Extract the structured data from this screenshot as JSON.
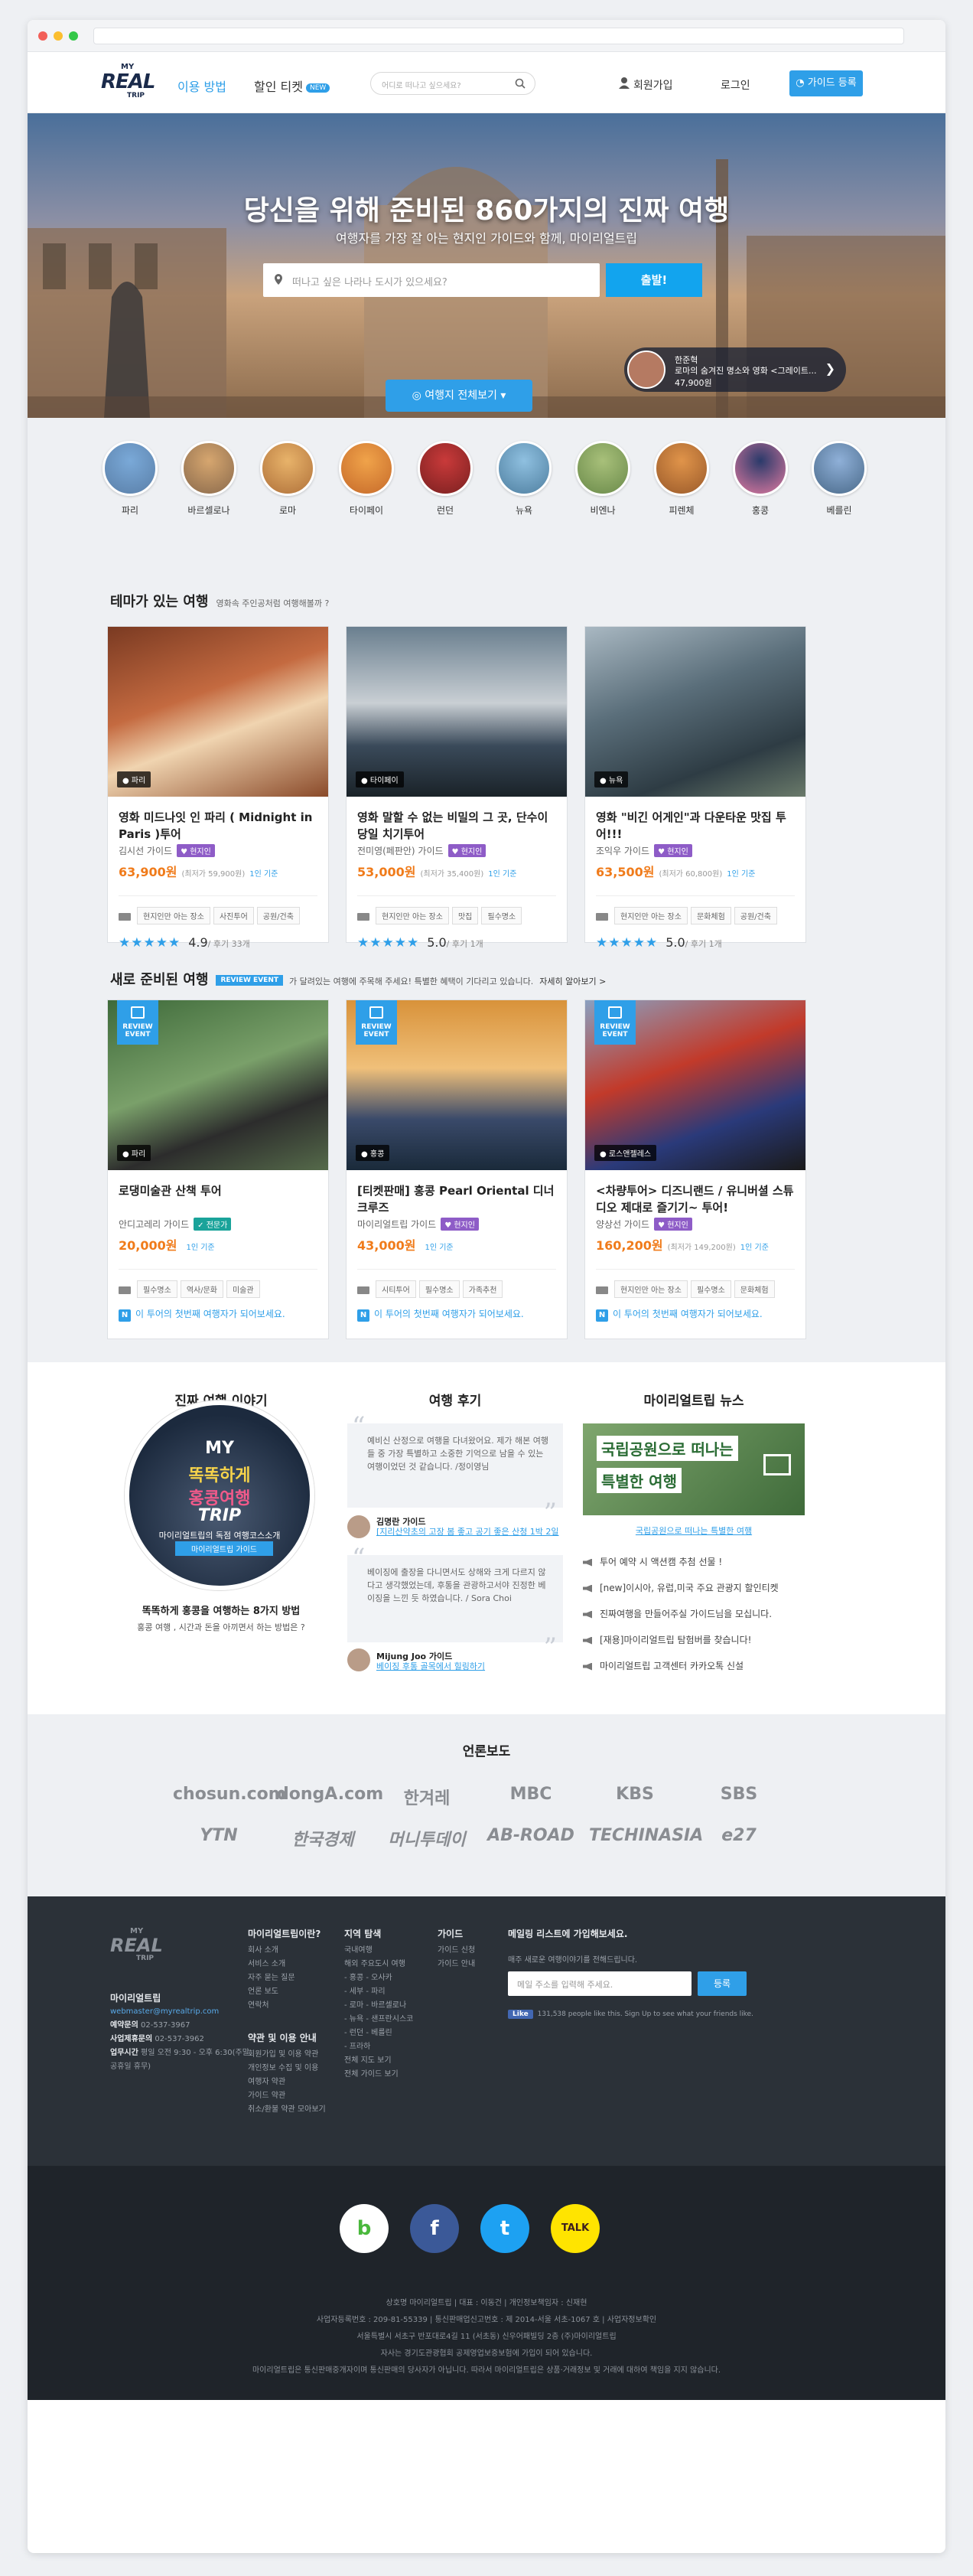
{
  "nav": {
    "menu1": "이용 방법",
    "menu2": "할인 티켓",
    "new_badge": "NEW",
    "search_placeholder": "어디로 떠나고 싶으세요?",
    "signup": "회원가입",
    "login": "로그인",
    "guide_register": "가이드 등록"
  },
  "logo": {
    "my": "MY",
    "real": "REAL",
    "trip": "TRIP"
  },
  "hero": {
    "title": "당신을 위해 준비된 860가지의 진짜 여행",
    "subtitle": "여행자를 가장 잘 아는 현지인 가이드와 함께, 마이리얼트립",
    "search_placeholder": "떠나고 싶은 나라나 도시가 있으세요?",
    "search_button": "출발!",
    "featured_guide": "한준혁",
    "featured_title": "로마의 숨겨진 명소와 영화 <그레이트...",
    "featured_price": "47,900원",
    "all_button": "여행지 전체보기"
  },
  "cities": [
    "파리",
    "바르셀로나",
    "로마",
    "타이페이",
    "런던",
    "뉴욕",
    "비엔나",
    "피렌체",
    "홍콩",
    "베를린"
  ],
  "theme": {
    "title": "테마가 있는 여행",
    "subtitle": "영화속 주인공처럼 여행해볼까 ?",
    "cards": [
      {
        "location": "파리",
        "title": "영화 미드나잇 인 파리 ( Midnight in Paris )투어",
        "guide": "김시선 가이드",
        "tag": "현지인",
        "price": "63,900원",
        "min": "(최저가 59,900원)",
        "people": "1인 기준",
        "chips": [
          "현지인만 아는 장소",
          "사진투어",
          "공원/건축"
        ],
        "stars": "★★★★★",
        "score": "4.9",
        "reviews": "/ 후기 33개"
      },
      {
        "location": "타이페이",
        "title": "영화 말할 수 없는 비밀의 그 곳, 단수이 당일 치기투어",
        "guide": "전미영(페판안) 가이드",
        "tag": "현지인",
        "price": "53,000원",
        "min": "(최저가 35,400원)",
        "people": "1인 기준",
        "chips": [
          "현지인만 아는 장소",
          "맛집",
          "필수명소"
        ],
        "stars": "★★★★★",
        "score": "5.0",
        "reviews": "/ 후기 1개"
      },
      {
        "location": "뉴욕",
        "title": "영화 \"비긴 어게인\"과 다운타운 맛집 투어!!!",
        "guide": "조익우 가이드",
        "tag": "현지인",
        "price": "63,500원",
        "min": "(최저가 60,800원)",
        "people": "1인 기준",
        "chips": [
          "현지인만 아는 장소",
          "문화체험",
          "공원/건축"
        ],
        "stars": "★★★★★",
        "score": "5.0",
        "reviews": "/ 후기 1개"
      }
    ]
  },
  "newtrip": {
    "title": "새로 준비된 여행",
    "badge": "REVIEW EVENT",
    "subtitle": "가 달려있는 여행에 주목해 주세요! 특별한 혜택이 기다리고 있습니다.",
    "more": "자세히 알아보기 >",
    "event_label1": "REVIEW",
    "event_label2": "EVENT",
    "cards": [
      {
        "location": "파리",
        "title": "로댕미술관 산책 투어",
        "guide": "안디고레리 가이드",
        "tag": "전문가",
        "tag_type": "pro",
        "price": "20,000원",
        "min": "",
        "people": "1인 기준",
        "chips": [
          "필수명소",
          "역사/문화",
          "미술관"
        ],
        "first": "이 투어의 첫번째 여행자가 되어보세요."
      },
      {
        "location": "홍콩",
        "title": "[티켓판매] 홍콩 Pearl Oriental 디너 크루즈",
        "guide": "마이리얼트립 가이드",
        "tag": "현지인",
        "tag_type": "local",
        "price": "43,000원",
        "min": "",
        "people": "1인 기준",
        "chips": [
          "시티투어",
          "필수명소",
          "가족추천"
        ],
        "first": "이 투어의 첫번째 여행자가 되어보세요."
      },
      {
        "location": "로스앤젤레스",
        "title": "<차량투어> 디즈니랜드 / 유니버셜 스튜디오 제대로 즐기기~ 투어!",
        "guide": "양상선 가이드",
        "tag": "현지인",
        "tag_type": "local",
        "price": "160,200원",
        "min": "(최저가 149,200원)",
        "people": "1인 기준",
        "chips": [
          "현지인만 아는 장소",
          "필수명소",
          "문화체험"
        ],
        "first": "이 투어의 첫번째 여행자가 되어보세요."
      }
    ]
  },
  "story": {
    "title": "진짜 여행 이야기",
    "c1": "MY",
    "c2": "똑똑하게",
    "c3": "홍콩여행",
    "c4": "TRIP",
    "c5": "마이리얼트립의 독점 여행코스소개",
    "c6": "마이리얼트립 가이드",
    "headline": "똑똑하게 홍콩을 여행하는 8가지 방법",
    "sub": "홍콩 여행 , 시간과 돈을 아끼면서 하는 방법은 ?"
  },
  "reviews": {
    "title": "여행 후기",
    "items": [
      {
        "text": "예비신 산정으로 여행을 다녀왔어요. 제가 해본 여행들 중 가장 특별하고 소중한 기억으로 남을 수 있는 여행이었던 것 같습니다. /정이영님",
        "name": "김명란 가이드",
        "link": "[지리산약초의 고장 봄 좋고 공기 좋은 산청 1박 2일"
      },
      {
        "text": "베이징에 출장을 다니면서도 상해와 크게 다르지 않다고 생각했었는데, 후통을 관광하고서야 진정한 베이징을 느낀 듯 하였습니다. / Sora Choi",
        "name": "Mijung Joo 가이드",
        "link": "베이징 후통 골목에서 힐링하기"
      }
    ]
  },
  "news": {
    "title": "마이리얼트립 뉴스",
    "img_line1": "국립공원으로 떠나는",
    "img_line2": "특별한 여행",
    "caption": "국립공원으로 떠나는 특별한 여행",
    "items": [
      "투어 예약 시 액션캠 추첨 선물 !",
      "[new]이시아, 유럽,미국 주요 관광지 할인티켓",
      "진짜여행을 만들어주실 가이드님을 모십니다.",
      "[재용]마이리얼트립 탐험버를 찾습니다!",
      "마이리얼트립 고객센터 카카오톡 신설"
    ]
  },
  "press": {
    "title": "언론보도",
    "row1": [
      "chosun.com",
      "dongA.com",
      "한겨레",
      "MBC",
      "KBS",
      "SBS"
    ],
    "row2": [
      "YTN",
      "한국경제",
      "머니투데이",
      "AB-ROAD",
      "TECHINASIA",
      "e27"
    ]
  },
  "footer": {
    "company": "마이리얼트립",
    "email": "webmaster@myrealtrip.com",
    "phone_label": "예약문의",
    "phone": "02-537-3967",
    "biz_label": "사업제휴문의",
    "biz_phone": "02-537-3962",
    "hours_label": "업무시간",
    "hours": "평일 오전 9:30 - 오후 6:30(주말, 공휴일 휴무)",
    "col1_title": "마이리얼트립이란?",
    "col1": [
      "회사 소개",
      "서비스 소개",
      "자주 묻는 질문",
      "언론 보도",
      "연락처"
    ],
    "col1b_title": "약관 및 이용 안내",
    "col1b": [
      "회원가입 및 이용 약관",
      "개인정보 수집 및 이용",
      "여행자 약관",
      "가이드 약관",
      "취소/환불 약관 모아보기"
    ],
    "col2_title": "지역 탐색",
    "col2": [
      "국내여행",
      "해외 주요도시 여행",
      "- 홍콩 - 오사카",
      "- 세부 - 파리",
      "- 로마 - 바르셀로나",
      "- 뉴욕 - 샌프란시스코",
      "- 런던 - 베를린",
      "- 프라하",
      "전체 지도 보기",
      "전체 가이드 보기"
    ],
    "col3_title": "가이드",
    "col3": [
      "가이드 신청",
      "가이드 안내"
    ],
    "mail_title": "메일링 리스트에 가입해보세요.",
    "mail_sub": "매주 새로운 여행이야기를 전해드립니다.",
    "mail_placeholder": "메일 주소를 입력해 주세요.",
    "mail_button": "등록",
    "fb_like": "Like",
    "fb_text": "131,538 people like this. Sign Up to see what your friends like."
  },
  "footer2": {
    "social": [
      "band-icon",
      "facebook-icon",
      "twitter-icon",
      "kakao-talk-icon"
    ],
    "lines": [
      "상호명 마이리얼트립 | 대표 : 이동건 | 개인정보책임자 : 신재현",
      "사업자등록번호 : 209-81-55339 | 통신판매업신고번호 : 제 2014-서울 서초-1067 호 | 사업자정보확인",
      "서울특별시 서초구 반포대로4길 11 (서초동) 신우어패빌딩 2층 (주)마이리얼트립",
      "자사는 경기도관광협회 공제영업보증보험에 가입이 되어 있습니다.",
      "마이리얼트립은 통신판매중개자이며 통신판매의 당사자가 아닙니다. 따라서 마이리얼트립은 상품·거래정보 및 거래에 대하여 책임을 지지 않습니다."
    ]
  }
}
